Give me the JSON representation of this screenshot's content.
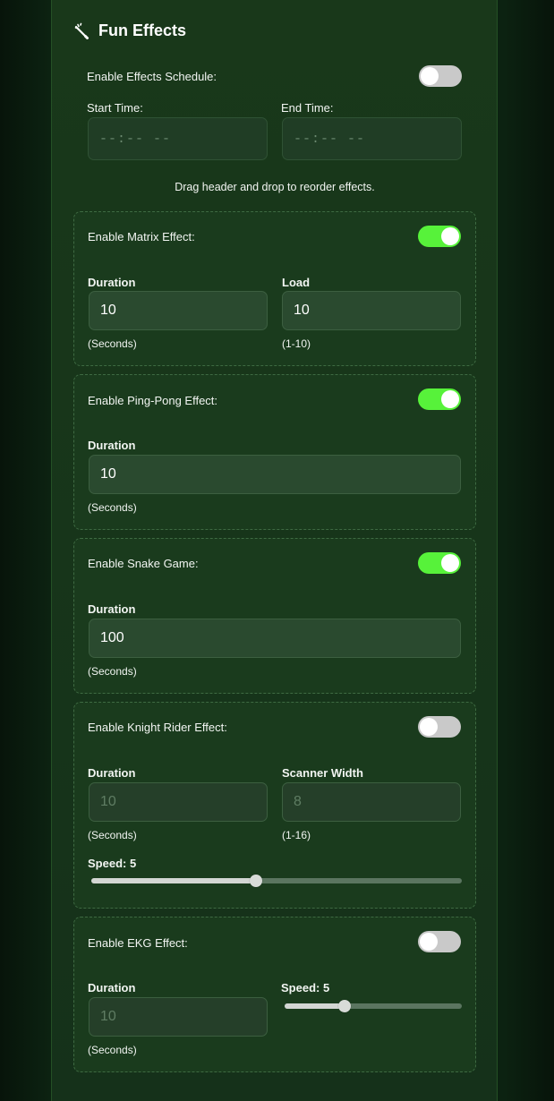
{
  "header": {
    "title": "Fun Effects",
    "icon": "magic-wand-icon"
  },
  "schedule": {
    "enable_label": "Enable Effects Schedule:",
    "enabled": false,
    "start_label": "Start Time:",
    "start_value": "--:-- --",
    "end_label": "End Time:",
    "end_value": "--:-- --"
  },
  "reorder_note": "Drag header and drop to reorder effects.",
  "effects": {
    "matrix": {
      "enable_label": "Enable Matrix Effect:",
      "enabled": true,
      "duration_label": "Duration",
      "duration_value": "10",
      "duration_hint": "(Seconds)",
      "load_label": "Load",
      "load_value": "10",
      "load_hint": "(1-10)"
    },
    "pingpong": {
      "enable_label": "Enable Ping-Pong Effect:",
      "enabled": true,
      "duration_label": "Duration",
      "duration_value": "10",
      "duration_hint": "(Seconds)"
    },
    "snake": {
      "enable_label": "Enable Snake Game:",
      "enabled": true,
      "duration_label": "Duration",
      "duration_value": "100",
      "duration_hint": "(Seconds)"
    },
    "knightrider": {
      "enable_label": "Enable Knight Rider Effect:",
      "enabled": false,
      "duration_label": "Duration",
      "duration_value": "10",
      "duration_hint": "(Seconds)",
      "width_label": "Scanner Width",
      "width_value": "8",
      "width_hint": "(1-16)",
      "speed_label": "Speed: 5",
      "speed_fraction": 0.445
    },
    "ekg": {
      "enable_label": "Enable EKG Effect:",
      "enabled": false,
      "duration_label": "Duration",
      "duration_value": "10",
      "duration_hint": "(Seconds)",
      "speed_label": "Speed: 5",
      "speed_fraction": 0.34
    }
  },
  "colors": {
    "toggle_on": "#57f23a",
    "toggle_off": "#c9c9c9",
    "background": "#0c2211",
    "panel": "#19381a"
  }
}
